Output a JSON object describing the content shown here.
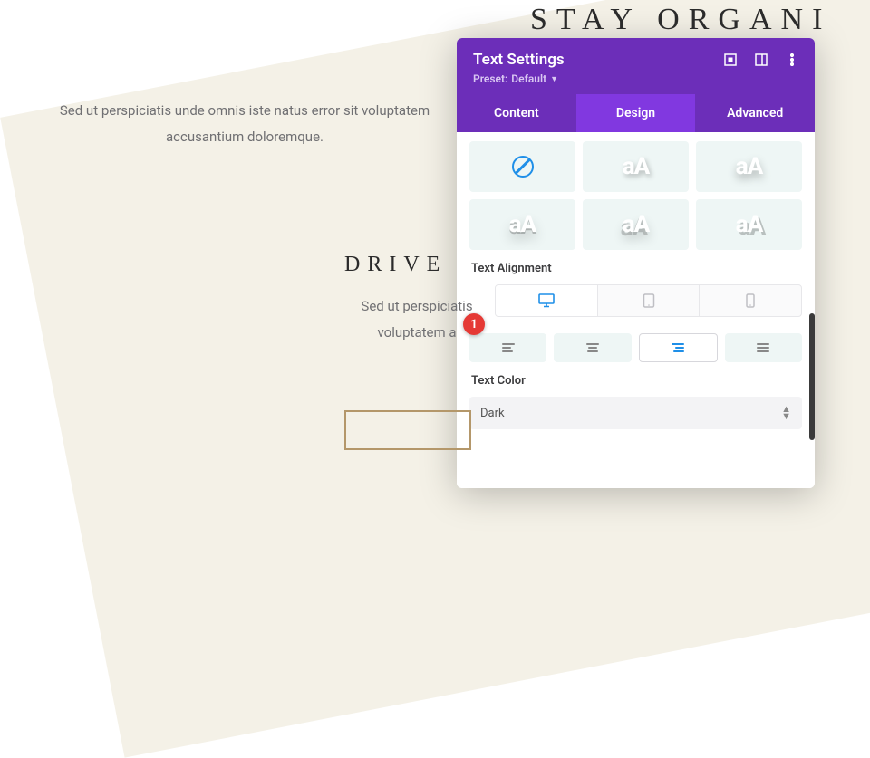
{
  "page": {
    "bg_heading": "STAY ORGANI",
    "para1": "Sed ut perspiciatis unde omnis iste natus error sit voluptatem accusantium doloremque.",
    "heading2": "DRIVE",
    "para2_l1": "Sed ut perspiciatis",
    "para2_l2": "voluptatem a"
  },
  "panel": {
    "title": "Text Settings",
    "preset_label": "Preset:",
    "preset_value": "Default",
    "tabs": {
      "content": "Content",
      "design": "Design",
      "advanced": "Advanced"
    },
    "sections": {
      "text_alignment": "Text Alignment",
      "text_color": "Text Color"
    },
    "text_color_value": "Dark",
    "text_style_glyph": "aA"
  },
  "marker": {
    "num": "1"
  }
}
